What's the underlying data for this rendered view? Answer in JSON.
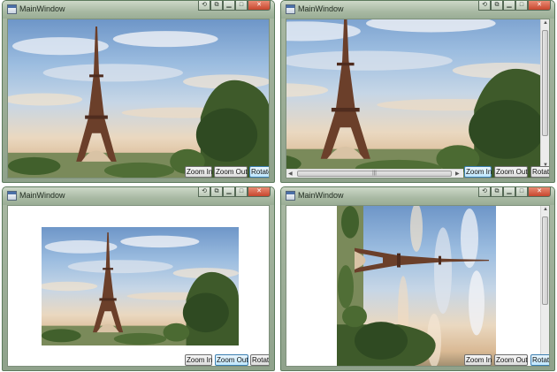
{
  "windows": [
    {
      "title": "MainWindow",
      "buttons": {
        "zoom_in": "Zoom In",
        "zoom_out": "Zoom Out",
        "rotate": "Rotate"
      },
      "focused_button": "rotate"
    },
    {
      "title": "MainWindow",
      "buttons": {
        "zoom_in": "Zoom In",
        "zoom_out": "Zoom Out",
        "rotate": "Rotate"
      },
      "focused_button": "zoom_in"
    },
    {
      "title": "MainWindow",
      "buttons": {
        "zoom_in": "Zoom In",
        "zoom_out": "Zoom Out",
        "rotate": "Rotate"
      },
      "focused_button": "zoom_out"
    },
    {
      "title": "MainWindow",
      "buttons": {
        "zoom_in": "Zoom In",
        "zoom_out": "Zoom Out",
        "rotate": "Rotate"
      },
      "focused_button": "rotate"
    }
  ],
  "titlebar_icons": [
    "help-icon",
    "restore-icon",
    "minimize-icon",
    "maximize-icon",
    "close-icon"
  ],
  "colors": {
    "sky": "#9cbde0",
    "tower": "#6b3f2a",
    "trees": "#3e5a2a",
    "focus": "#3c7fb1"
  }
}
